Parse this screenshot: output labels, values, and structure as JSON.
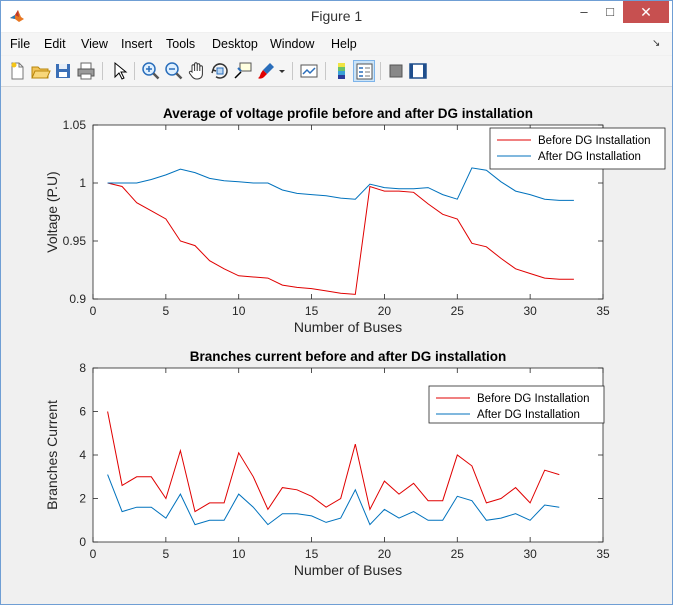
{
  "window": {
    "title": "Figure 1",
    "minimize": "–",
    "maximize": "□",
    "close": "✕"
  },
  "menu": [
    "File",
    "Edit",
    "View",
    "Insert",
    "Tools",
    "Desktop",
    "Window",
    "Help"
  ],
  "toolbar_icons": [
    "new-figure-icon",
    "open-file-icon",
    "save-icon",
    "print-icon",
    "edit-plot-arrow-icon",
    "zoom-in-icon",
    "zoom-out-icon",
    "pan-hand-icon",
    "rotate-3d-icon",
    "data-cursor-icon",
    "brush-icon",
    "brush-dropdown-icon",
    "link-plot-icon",
    "colorbar-icon",
    "legend-icon",
    "hide-plot-tools-icon",
    "show-plot-tools-icon"
  ],
  "colors": {
    "before": "#e00000",
    "after": "#0072bd",
    "close_button": "#c75050"
  },
  "chart_data": [
    {
      "type": "line",
      "title": "Average of voltage profile before and after DG installation",
      "xlabel": "Number of Buses",
      "ylabel": "Voltage (P.U)",
      "xlim": [
        0,
        35
      ],
      "ylim": [
        0.9,
        1.05
      ],
      "xticks": [
        0,
        5,
        10,
        15,
        20,
        25,
        30,
        35
      ],
      "yticks": [
        0.9,
        0.95,
        1,
        1.05
      ],
      "ytick_labels": [
        "0.9",
        "0.95",
        "1",
        "1.05"
      ],
      "legend_position": "top-right",
      "x": [
        1,
        2,
        3,
        4,
        5,
        6,
        7,
        8,
        9,
        10,
        11,
        12,
        13,
        14,
        15,
        16,
        17,
        18,
        19,
        20,
        21,
        22,
        23,
        24,
        25,
        26,
        27,
        28,
        29,
        30,
        31,
        32,
        33
      ],
      "series": [
        {
          "name": "Before DG Installation",
          "color": "#e00000",
          "values": [
            1.0,
            0.997,
            0.983,
            0.976,
            0.969,
            0.95,
            0.946,
            0.933,
            0.926,
            0.92,
            0.919,
            0.918,
            0.912,
            0.91,
            0.909,
            0.907,
            0.905,
            0.904,
            0.997,
            0.993,
            0.993,
            0.992,
            0.982,
            0.973,
            0.969,
            0.948,
            0.945,
            0.935,
            0.926,
            0.922,
            0.918,
            0.917,
            0.917
          ]
        },
        {
          "name": "After DG Installation",
          "color": "#0072bd",
          "values": [
            1.0,
            1.0,
            1.0,
            1.003,
            1.007,
            1.012,
            1.009,
            1.004,
            1.002,
            1.001,
            1.0,
            1.0,
            0.994,
            0.991,
            0.99,
            0.989,
            0.987,
            0.986,
            0.999,
            0.996,
            0.995,
            0.995,
            0.996,
            0.99,
            0.986,
            1.013,
            1.011,
            1.001,
            0.993,
            0.99,
            0.986,
            0.985,
            0.985
          ]
        }
      ]
    },
    {
      "type": "line",
      "title": "Branches current before and after DG installation",
      "xlabel": "Number of Buses",
      "ylabel": "Branches Current",
      "xlim": [
        0,
        35
      ],
      "ylim": [
        0,
        8
      ],
      "xticks": [
        0,
        5,
        10,
        15,
        20,
        25,
        30,
        35
      ],
      "yticks": [
        0,
        2,
        4,
        6,
        8
      ],
      "ytick_labels": [
        "0",
        "2",
        "4",
        "6",
        "8"
      ],
      "legend_position": "top-right",
      "x": [
        1,
        2,
        3,
        4,
        5,
        6,
        7,
        8,
        9,
        10,
        11,
        12,
        13,
        14,
        15,
        16,
        17,
        18,
        19,
        20,
        21,
        22,
        23,
        24,
        25,
        26,
        27,
        28,
        29,
        30,
        31,
        32
      ],
      "series": [
        {
          "name": "Before DG Installation",
          "color": "#e00000",
          "values": [
            6.0,
            2.6,
            3.0,
            3.0,
            2.0,
            4.2,
            1.4,
            1.8,
            1.8,
            4.1,
            3.0,
            1.5,
            2.5,
            2.4,
            2.1,
            1.6,
            2.0,
            4.5,
            1.5,
            2.8,
            2.2,
            2.7,
            1.9,
            1.9,
            4.0,
            3.5,
            1.8,
            2.0,
            2.5,
            1.8,
            3.3,
            3.1
          ]
        },
        {
          "name": "After DG Installation",
          "color": "#0072bd",
          "values": [
            3.1,
            1.4,
            1.6,
            1.6,
            1.1,
            2.2,
            0.8,
            1.0,
            1.0,
            2.2,
            1.6,
            0.8,
            1.3,
            1.3,
            1.2,
            0.9,
            1.1,
            2.4,
            0.8,
            1.5,
            1.1,
            1.4,
            1.0,
            1.0,
            2.1,
            1.9,
            1.0,
            1.1,
            1.3,
            1.0,
            1.7,
            1.6
          ]
        }
      ]
    }
  ]
}
